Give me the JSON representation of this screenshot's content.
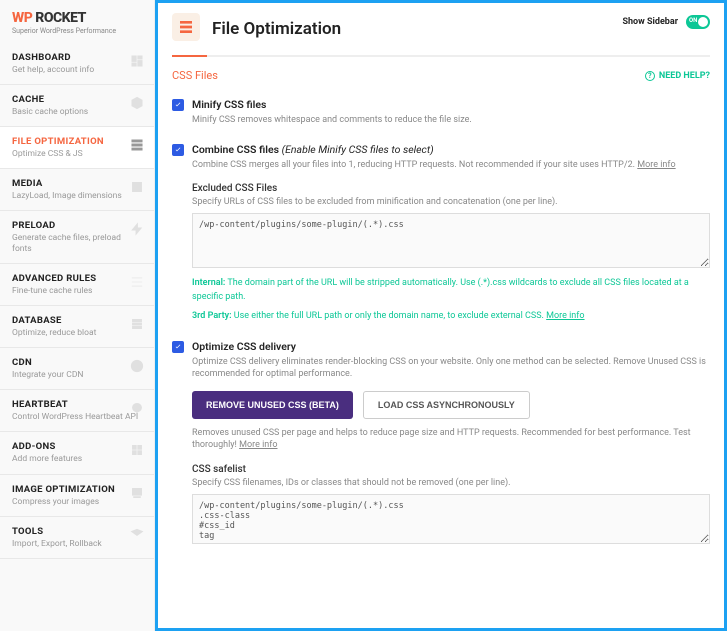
{
  "logo": {
    "wp": "WP",
    "rocket": "ROCKET",
    "sub": "Superior WordPress Performance"
  },
  "nav": [
    {
      "title": "DASHBOARD",
      "sub": "Get help, account info"
    },
    {
      "title": "CACHE",
      "sub": "Basic cache options"
    },
    {
      "title": "FILE OPTIMIZATION",
      "sub": "Optimize CSS & JS"
    },
    {
      "title": "MEDIA",
      "sub": "LazyLoad, Image dimensions"
    },
    {
      "title": "PRELOAD",
      "sub": "Generate cache files, preload fonts"
    },
    {
      "title": "ADVANCED RULES",
      "sub": "Fine-tune cache rules"
    },
    {
      "title": "DATABASE",
      "sub": "Optimize, reduce bloat"
    },
    {
      "title": "CDN",
      "sub": "Integrate your CDN"
    },
    {
      "title": "HEARTBEAT",
      "sub": "Control WordPress Heartbeat API"
    },
    {
      "title": "ADD-ONS",
      "sub": "Add more features"
    },
    {
      "title": "IMAGE OPTIMIZATION",
      "sub": "Compress your images"
    },
    {
      "title": "TOOLS",
      "sub": "Import, Export, Rollback"
    }
  ],
  "header": {
    "title": "File Optimization",
    "show_sidebar": "Show Sidebar",
    "on": "ON"
  },
  "section": {
    "css_files": "CSS Files",
    "need_help": "NEED HELP?"
  },
  "minify": {
    "label": "Minify CSS files",
    "desc": "Minify CSS removes whitespace and comments to reduce the file size."
  },
  "combine": {
    "label": "Combine CSS files",
    "label_em": "(Enable Minify CSS files to select)",
    "desc": "Combine CSS merges all your files into 1, reducing HTTP requests. Not recommended if your site uses HTTP/2.",
    "more": "More info",
    "excluded_label": "Excluded CSS Files",
    "excluded_desc": "Specify URLs of CSS files to be excluded from minification and concatenation (one per line).",
    "textarea": "/wp-content/plugins/some-plugin/(.*).css",
    "note1_lbl": "Internal:",
    "note1": " The domain part of the URL will be stripped automatically. Use (.*).css wildcards to exclude all CSS files located at a specific path.",
    "note2_lbl": "3rd Party:",
    "note2": " Use either the full URL path or only the domain name, to exclude external CSS.",
    "note2_more": "More info"
  },
  "optimize": {
    "label": "Optimize CSS delivery",
    "desc": "Optimize CSS delivery eliminates render-blocking CSS on your website. Only one method can be selected. Remove Unused CSS is recommended for optimal performance.",
    "btn1": "REMOVE UNUSED CSS (BETA)",
    "btn2": "LOAD CSS ASYNCHRONOUSLY",
    "result": "Removes unused CSS per page and helps to reduce page size and HTTP requests. Recommended for best performance. Test thoroughly!",
    "result_more": "More info",
    "safelist_label": "CSS safelist",
    "safelist_desc": "Specify CSS filenames, IDs or classes that should not be removed (one per line).",
    "safelist_textarea": "/wp-content/plugins/some-plugin/(.*).css\n.css-class\n#css_id\ntag"
  }
}
